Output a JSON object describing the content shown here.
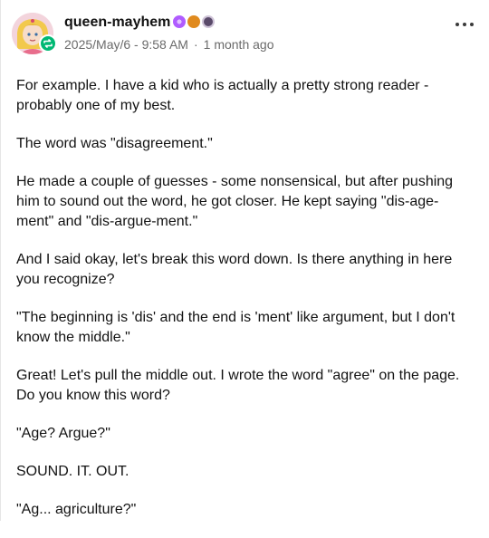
{
  "post": {
    "username": "queen-mayhem",
    "date": "2025/May/6 - 9:58 AM",
    "relative_time": "1 month ago",
    "separator": "·",
    "badge_colors": [
      "#b05cff",
      "#e08a1e",
      "#5a4a6a"
    ],
    "paragraphs": [
      "For example. I have a kid who is actually a pretty strong reader - probably one of my best.",
      "The word was \"disagreement.\"",
      "He made a couple of guesses - some nonsensical, but after pushing him to sound out the word, he got closer. He kept saying \"dis-age-ment\" and \"dis-argue-ment.\"",
      "And I said okay, let's break this word down. Is there anything in here you recognize?",
      "\"The beginning is 'dis' and the end is 'ment' like argument, but I don't know the middle.\"",
      "Great! Let's pull the middle out. I wrote the word \"agree\" on the page. Do you know this word?",
      "\"Age? Argue?\"",
      "SOUND. IT. OUT.",
      "\"Ag... agriculture?\""
    ]
  }
}
